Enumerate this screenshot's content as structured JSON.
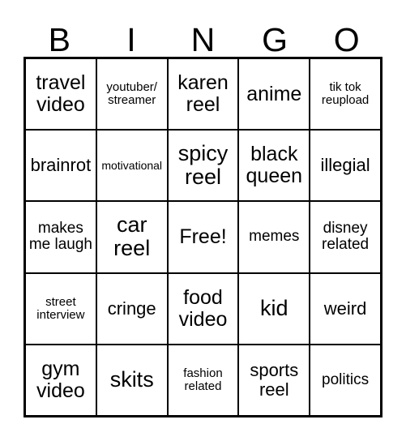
{
  "card": {
    "header_letters": [
      "B",
      "I",
      "N",
      "G",
      "O"
    ],
    "free_space_label": "Free!",
    "grid_size": "5x5",
    "colors": {
      "background": "#ffffff",
      "text": "#000000",
      "grid_line": "#000000"
    },
    "rows": [
      [
        {
          "text": "travel video",
          "size": "size-lg"
        },
        {
          "text": "youtuber/ streamer",
          "size": "size-xs"
        },
        {
          "text": "karen reel",
          "size": "size-lg"
        },
        {
          "text": "anime",
          "size": "size-lg"
        },
        {
          "text": "tik tok reupload",
          "size": "size-xs"
        }
      ],
      [
        {
          "text": "brainrot",
          "size": "size-md"
        },
        {
          "text": "motivational",
          "size": "size-xxs"
        },
        {
          "text": "spicy reel",
          "size": "size-xl"
        },
        {
          "text": "black queen",
          "size": "size-lg"
        },
        {
          "text": "illegial",
          "size": "size-md"
        }
      ],
      [
        {
          "text": "makes me laugh",
          "size": "size-sm"
        },
        {
          "text": "car reel",
          "size": "size-xl"
        },
        {
          "text": "Free!",
          "size": "size-lg"
        },
        {
          "text": "memes",
          "size": "size-sm"
        },
        {
          "text": "disney related",
          "size": "size-sm"
        }
      ],
      [
        {
          "text": "street interview",
          "size": "size-xs"
        },
        {
          "text": "cringe",
          "size": "size-md"
        },
        {
          "text": "food video",
          "size": "size-lg"
        },
        {
          "text": "kid",
          "size": "size-xl"
        },
        {
          "text": "weird",
          "size": "size-md"
        }
      ],
      [
        {
          "text": "gym video",
          "size": "size-lg"
        },
        {
          "text": "skits",
          "size": "size-xl"
        },
        {
          "text": "fashion related",
          "size": "size-xs"
        },
        {
          "text": "sports reel",
          "size": "size-md"
        },
        {
          "text": "politics",
          "size": "size-sm"
        }
      ]
    ]
  }
}
